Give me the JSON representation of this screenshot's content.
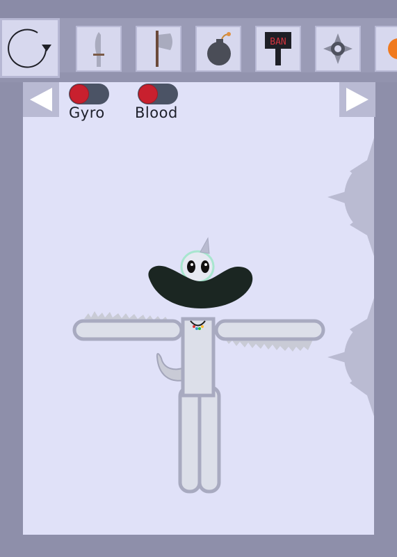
{
  "toolbar": {
    "tools": [
      {
        "name": "reset-tool",
        "icon": "rotate-arrow-icon"
      },
      {
        "name": "knife-tool",
        "icon": "knife-icon"
      },
      {
        "name": "axe-tool",
        "icon": "axe-icon"
      },
      {
        "name": "bomb-tool",
        "icon": "bomb-icon"
      },
      {
        "name": "ban-hammer-tool",
        "icon": "ban-sign-icon",
        "text": "BAN"
      },
      {
        "name": "shuriken-tool",
        "icon": "shuriken-icon"
      },
      {
        "name": "orb-tool",
        "icon": "orange-orb-icon"
      }
    ]
  },
  "toggles": {
    "gyro": {
      "label": "Gyro",
      "state": "off"
    },
    "blood": {
      "label": "Blood",
      "state": "off"
    }
  },
  "colors": {
    "background": "#e0e1f8",
    "frame": "#8f90ab",
    "toggle_knob": "#c8202e",
    "toggle_track": "#4b5365",
    "ragdoll_fill": "#dcdfe9",
    "ragdoll_outline": "#a8aac0",
    "hat": "#1b2622"
  }
}
